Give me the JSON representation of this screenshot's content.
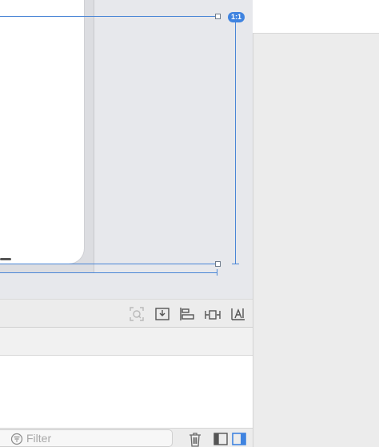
{
  "canvas": {
    "ratio_badge": "1:1"
  },
  "toolbar": {
    "icons": [
      "update-frames-icon",
      "embed-in-icon",
      "align-icon",
      "add-constraints-icon",
      "resolve-issues-icon"
    ]
  },
  "bottom_bar": {
    "filter_placeholder": "Filter",
    "icons": [
      "filter-icon",
      "trash-icon",
      "hide-navigator-icon",
      "hide-inspector-icon"
    ]
  },
  "colors": {
    "guide": "#4b86d6",
    "accent": "#3f83e0",
    "canvas_bg": "#e7e8ec",
    "panel_bg": "#ececec"
  }
}
